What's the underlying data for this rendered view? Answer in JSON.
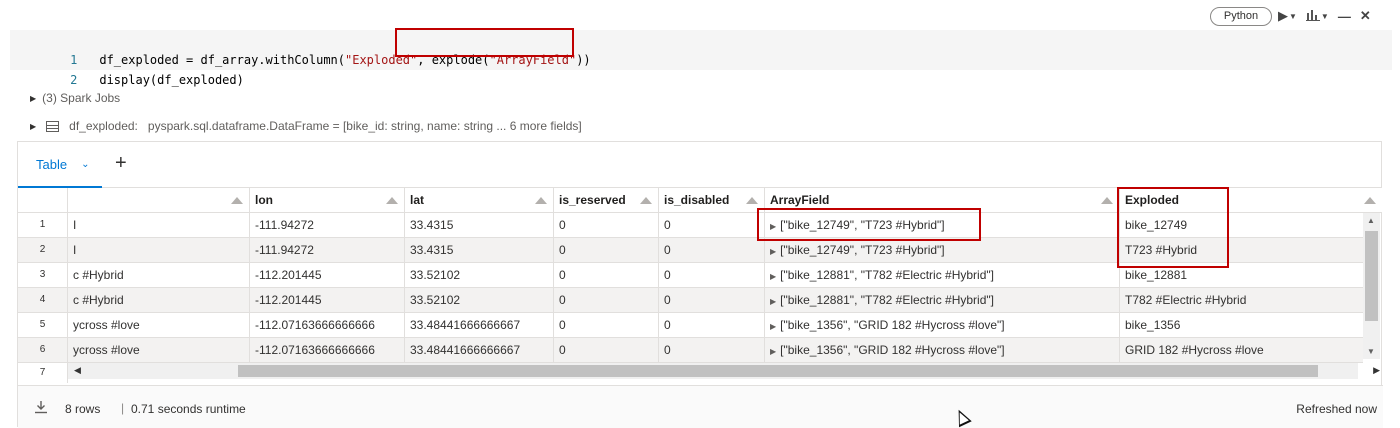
{
  "toolbar": {
    "language": "Python",
    "icons": [
      "run-icon",
      "run-dropdown-icon",
      "chart-icon",
      "chart-dropdown-icon",
      "minimize-icon",
      "close-icon"
    ]
  },
  "code": {
    "lines": [
      {
        "number": "1",
        "prefix": "df_exploded = df_array.withColumn(",
        "str1": "\"Exploded\"",
        "mid": ", explode(",
        "str2": "\"ArrayField\"",
        "suffix": "))"
      },
      {
        "number": "2",
        "text": "display(df_exploded)"
      }
    ]
  },
  "outputs": {
    "spark_jobs": "(3) Spark Jobs",
    "df_name": "df_exploded:",
    "df_schema": "pyspark.sql.dataframe.DataFrame = [bike_id: string, name: string ... 6 more fields]"
  },
  "result": {
    "tab_label": "Table",
    "add_tab": "+",
    "columns": [
      "",
      "lon",
      "lat",
      "is_reserved",
      "is_disabled",
      "ArrayField",
      "Exploded"
    ],
    "rows": [
      {
        "n": "1",
        "c0": "I",
        "lon": "-111.94272",
        "lat": "33.4315",
        "is_reserved": "0",
        "is_disabled": "0",
        "array": "[\"bike_12749\", \"T723 #Hybrid\"]",
        "exploded": "bike_12749"
      },
      {
        "n": "2",
        "c0": "I",
        "lon": "-111.94272",
        "lat": "33.4315",
        "is_reserved": "0",
        "is_disabled": "0",
        "array": "[\"bike_12749\", \"T723 #Hybrid\"]",
        "exploded": "T723 #Hybrid"
      },
      {
        "n": "3",
        "c0": "c #Hybrid",
        "lon": "-112.201445",
        "lat": "33.52102",
        "is_reserved": "0",
        "is_disabled": "0",
        "array": "[\"bike_12881\", \"T782 #Electric #Hybrid\"]",
        "exploded": "bike_12881"
      },
      {
        "n": "4",
        "c0": "c #Hybrid",
        "lon": "-112.201445",
        "lat": "33.52102",
        "is_reserved": "0",
        "is_disabled": "0",
        "array": "[\"bike_12881\", \"T782 #Electric #Hybrid\"]",
        "exploded": "T782 #Electric #Hybrid"
      },
      {
        "n": "5",
        "c0": "ycross #love",
        "lon": "-112.07163666666666",
        "lat": "33.48441666666667",
        "is_reserved": "0",
        "is_disabled": "0",
        "array": "[\"bike_1356\", \"GRID 182 #Hycross #love\"]",
        "exploded": "bike_1356"
      },
      {
        "n": "6",
        "c0": "ycross #love",
        "lon": "-112.07163666666666",
        "lat": "33.48441666666667",
        "is_reserved": "0",
        "is_disabled": "0",
        "array": "[\"bike_1356\", \"GRID 182 #Hycross #love\"]",
        "exploded": "GRID 182 #Hycross #love"
      },
      {
        "n": "7"
      }
    ],
    "footer": {
      "rows_count": "8 rows",
      "separator": "|",
      "runtime": "0.71 seconds runtime",
      "refreshed": "Refreshed now"
    }
  },
  "colors": {
    "accent": "#0078d4",
    "highlight_box": "#c00000",
    "code_string": "#a31515",
    "line_number": "#237893"
  }
}
